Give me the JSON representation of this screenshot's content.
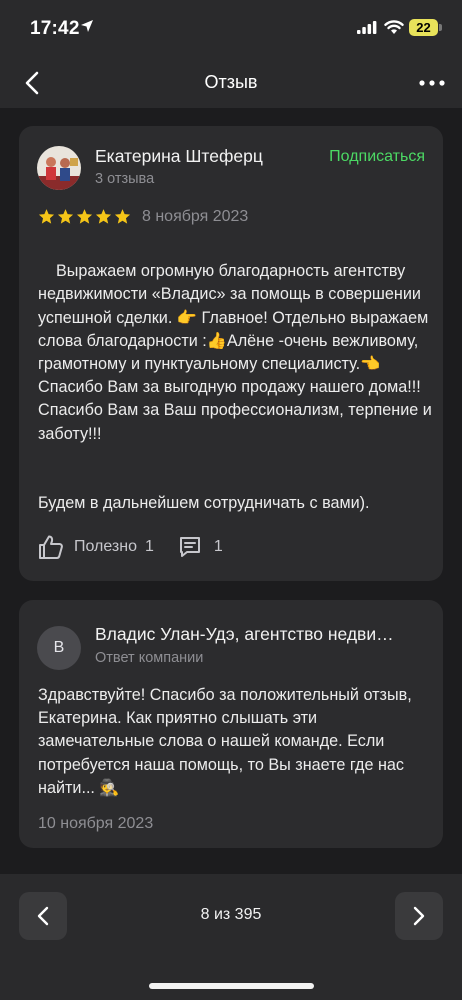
{
  "status_bar": {
    "time": "17:42",
    "battery": "22"
  },
  "nav": {
    "title": "Отзыв",
    "back_icon": "chevron-left-icon",
    "more_icon": "more-horizontal-icon"
  },
  "review": {
    "author": "Екатерина Штеферц",
    "review_count": "3 отзыва",
    "subscribe_label": "Подписаться",
    "rating": 5,
    "date": "8 ноября 2023",
    "text_main": "Выражаем огромную благодарность агентству недвижимости «Владис» за помощь в совершении успешной сделки. 👉 Главное! Отдельно выражаем слова благодарности :👍Алёне -очень вежливому, грамотному и пунктуальному специалисту.👈 Спасибо Вам за выгодную продажу нашего дома!!! Спасибо Вам за Ваш профессионализм, терпение и заботу!!!",
    "text_closing": "Будем в дальнейшем сотрудничать с вами).",
    "helpful_label": "Полезно",
    "helpful_count": "1",
    "comments_count": "1"
  },
  "reply": {
    "avatar_letter": "В",
    "company": "Владис Улан-Удэ, агентство недвижимости",
    "label": "Ответ компании",
    "text": "Здравствуйте! Спасибо за положительный отзыв, Екатерина. Как приятно слышать эти замечательные слова о нашей команде. Если потребуется наша помощь, то Вы знаете где нас найти... 🕵️",
    "date": "10 ноября 2023"
  },
  "pager": {
    "text": "8 из 395"
  },
  "colors": {
    "accent_green": "#4cd964",
    "star": "#f5c518",
    "card_bg": "#2c2c2e",
    "page_bg": "#1c1c1e"
  }
}
